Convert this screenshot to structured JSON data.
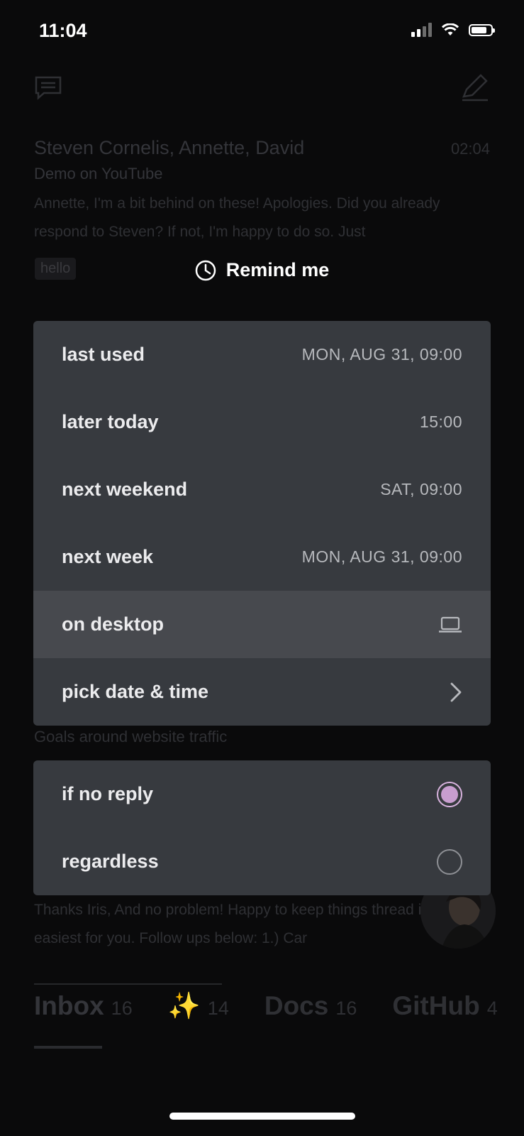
{
  "status_bar": {
    "time": "11:04"
  },
  "background": {
    "email": {
      "sender": "Steven Cornelis, Annette, David",
      "time": "02:04",
      "subject": "Demo on YouTube",
      "preview": "Annette, I'm a bit behind on these! Apologies. Did you already respond to Steven? If not, I'm happy to do so. Just"
    },
    "label": "hello",
    "email2_subject": "Goals around website traffic",
    "email3_preview": "Thanks Iris, And no problem! Happy to keep things thread if that's easiest for you. Follow ups below: 1.) Car",
    "tabs": [
      {
        "label": "Inbox",
        "count": "16"
      },
      {
        "label": "✨",
        "count": "14"
      },
      {
        "label": "Docs",
        "count": "16"
      },
      {
        "label": "GitHub",
        "count": "4"
      }
    ]
  },
  "remind": {
    "title": "Remind me",
    "options": [
      {
        "label": "last used",
        "value": "MON, AUG 31, 09:00"
      },
      {
        "label": "later today",
        "value": "15:00"
      },
      {
        "label": "next weekend",
        "value": "SAT, 09:00"
      },
      {
        "label": "next week",
        "value": "MON, AUG 31, 09:00"
      },
      {
        "label": "on desktop",
        "icon": "laptop-icon"
      },
      {
        "label": "pick date & time",
        "icon": "chevron-right-icon"
      }
    ],
    "modes": [
      {
        "label": "if no reply",
        "selected": true
      },
      {
        "label": "regardless",
        "selected": false
      }
    ]
  },
  "colors": {
    "accent_radio": "#c89ecf",
    "sheet_bg": "#373a3f",
    "highlight_row": "#47494e"
  }
}
